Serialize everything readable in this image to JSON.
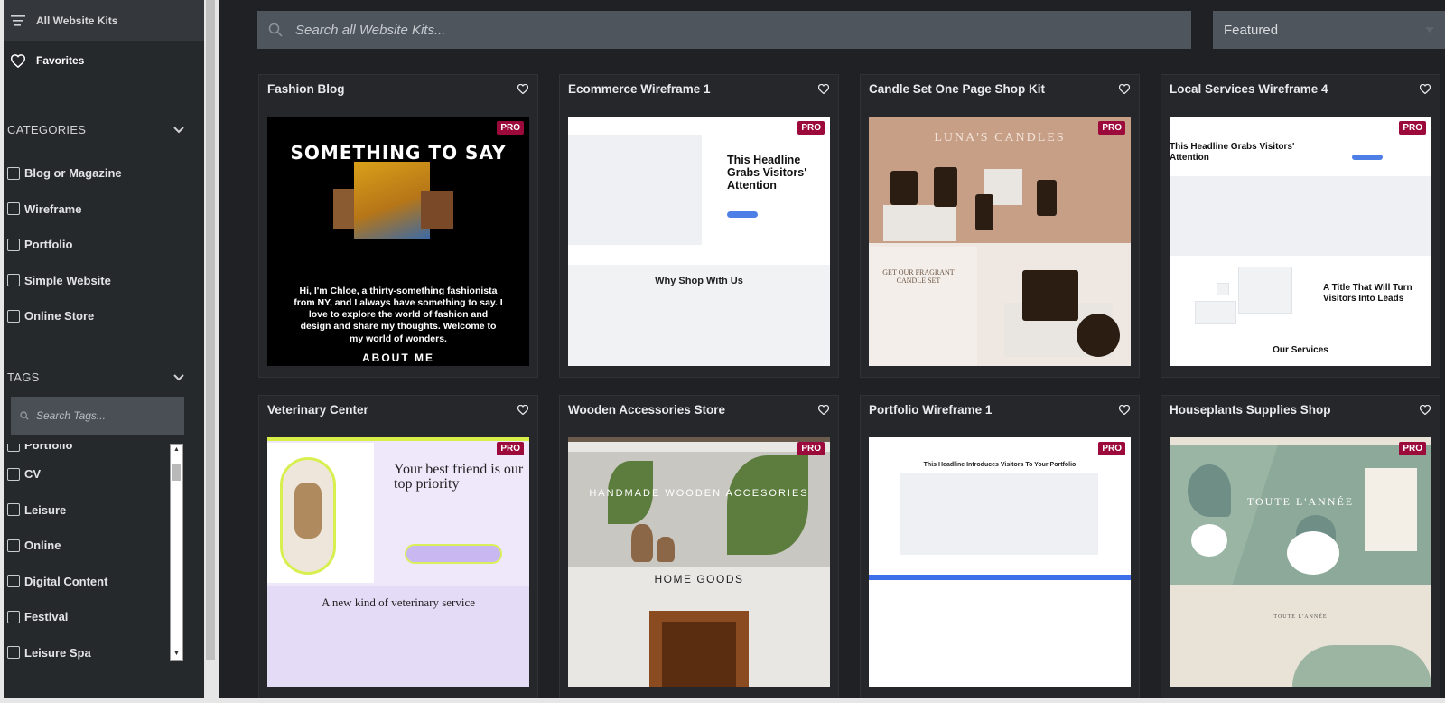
{
  "sidebar": {
    "all_kits_label": "All Website Kits",
    "favorites_label": "Favorites",
    "categories_heading": "CATEGORIES",
    "categories": [
      "Blog or Magazine",
      "Wireframe",
      "Portfolio",
      "Simple Website",
      "Online Store"
    ],
    "tags_heading": "TAGS",
    "tags_search_placeholder": "Search Tags...",
    "tags_partial": "Portfolio",
    "tags": [
      "CV",
      "Leisure",
      "Online",
      "Digital Content",
      "Festival",
      "Leisure Spa"
    ]
  },
  "main": {
    "search_placeholder": "Search all Website Kits...",
    "sort_value": "Featured",
    "pro_badge": "PRO",
    "cards": [
      {
        "title": "Fashion Blog"
      },
      {
        "title": "Ecommerce Wireframe 1"
      },
      {
        "title": "Candle Set One Page Shop Kit"
      },
      {
        "title": "Local Services Wireframe 4"
      },
      {
        "title": "Veterinary Center"
      },
      {
        "title": "Wooden Accessories Store"
      },
      {
        "title": "Portfolio Wireframe 1"
      },
      {
        "title": "Houseplants Supplies Shop"
      }
    ],
    "thumbs": {
      "fashion": {
        "headline": "SOMETHING TO SAY",
        "paragraph": "Hi, I'm Chloe, a thirty-something fashionista from NY, and I always have something to say. I love to explore the world of fashion and design and share my thoughts. Welcome to my world of wonders.",
        "cta": "ABOUT ME"
      },
      "ecommerce": {
        "headline": "This Headline Grabs Visitors' Attention",
        "section": "Why Shop With Us"
      },
      "candle": {
        "brand": "LUNA'S CANDLES",
        "offer": "GET OUR FRAGRANT CANDLE SET"
      },
      "local": {
        "headline": "This Headline Grabs Visitors' Attention",
        "headline2": "A Title That Will Turn Visitors Into Leads",
        "section": "Our Services"
      },
      "vet": {
        "headline": "Your best friend is our top priority",
        "subhead": "A new kind of veterinary service"
      },
      "wood": {
        "hero": "HANDMADE WOODEN ACCESORIES",
        "section": "HOME GOODS"
      },
      "portfolio": {
        "headline": "This Headline Introduces Visitors To Your Portfolio"
      },
      "plants": {
        "brand": "TOUTE L'ANNÉE",
        "brand_small": "TOUTE L'ANNÉE"
      }
    }
  },
  "colors": {
    "pro_badge": "#9b0a3a",
    "accent_blue": "#4e7fe6"
  }
}
